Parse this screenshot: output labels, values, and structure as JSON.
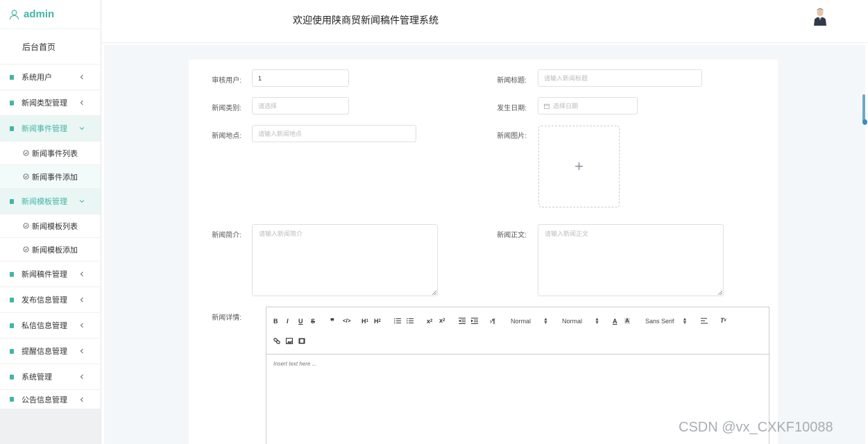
{
  "sidebar": {
    "username": "admin",
    "home": "后台首页",
    "menu": [
      {
        "label": "系统用户",
        "open": false
      },
      {
        "label": "新闻类型管理",
        "open": false
      },
      {
        "label": "新闻事件管理",
        "open": true
      },
      {
        "label": "新闻模板管理",
        "open": true
      },
      {
        "label": "新闻稿件管理",
        "open": false
      },
      {
        "label": "发布信息管理",
        "open": false
      },
      {
        "label": "私信信息管理",
        "open": false
      },
      {
        "label": "提醒信息管理",
        "open": false
      },
      {
        "label": "系统管理",
        "open": false
      },
      {
        "label": "公告信息管理",
        "open": false
      }
    ],
    "event_sub": [
      "新闻事件列表",
      "新闻事件添加"
    ],
    "template_sub": [
      "新闻模板列表",
      "新闻模板添加"
    ]
  },
  "header": {
    "title": "欢迎使用陕商贸新闻稿件管理系统"
  },
  "form": {
    "reviewer": {
      "label": "审核用户:",
      "value": "1"
    },
    "title": {
      "label": "新闻标题:",
      "placeholder": "请输入新闻标题"
    },
    "category": {
      "label": "新闻类别:",
      "placeholder": "请选择"
    },
    "date": {
      "label": "发生日期:",
      "placeholder": "选择日期"
    },
    "location": {
      "label": "新闻地点:",
      "placeholder": "请输入新闻地点"
    },
    "image": {
      "label": "新闻图片:"
    },
    "summary": {
      "label": "新闻简介:",
      "placeholder": "请输入新闻简介"
    },
    "body": {
      "label": "新闻正文:",
      "placeholder": "请输入新闻正文"
    },
    "details": {
      "label": "新闻详情:"
    }
  },
  "editor": {
    "header_select": "Normal",
    "size_select": "Normal",
    "font_select": "Sans Serif",
    "placeholder": "Insert text here ..."
  },
  "watermark": "CSDN @vx_CXKF10088",
  "colors": {
    "accent": "#42b5a7"
  }
}
